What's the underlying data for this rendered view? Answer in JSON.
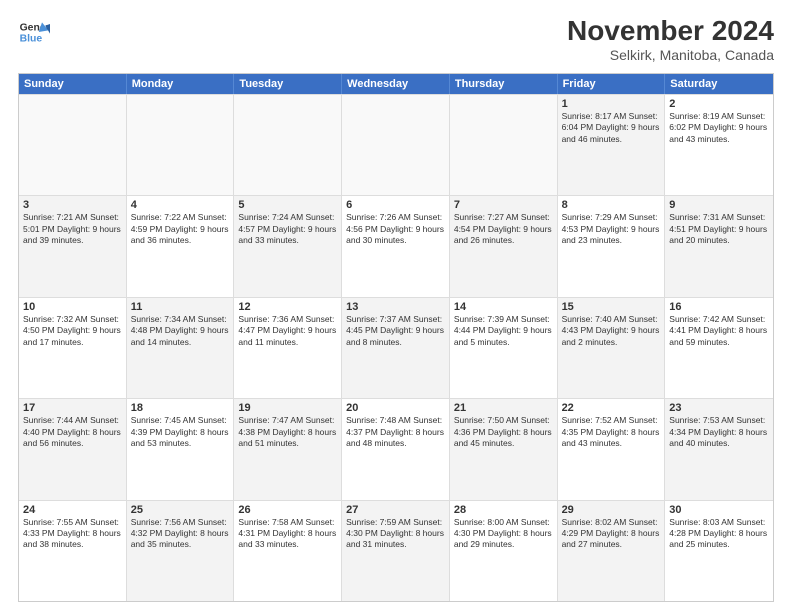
{
  "logo": {
    "line1": "General",
    "line2": "Blue"
  },
  "title": "November 2024",
  "subtitle": "Selkirk, Manitoba, Canada",
  "headers": [
    "Sunday",
    "Monday",
    "Tuesday",
    "Wednesday",
    "Thursday",
    "Friday",
    "Saturday"
  ],
  "rows": [
    [
      {
        "day": "",
        "info": "",
        "empty": true
      },
      {
        "day": "",
        "info": "",
        "empty": true
      },
      {
        "day": "",
        "info": "",
        "empty": true
      },
      {
        "day": "",
        "info": "",
        "empty": true
      },
      {
        "day": "",
        "info": "",
        "empty": true
      },
      {
        "day": "1",
        "info": "Sunrise: 8:17 AM\nSunset: 6:04 PM\nDaylight: 9 hours and 46 minutes.",
        "shaded": true
      },
      {
        "day": "2",
        "info": "Sunrise: 8:19 AM\nSunset: 6:02 PM\nDaylight: 9 hours and 43 minutes."
      }
    ],
    [
      {
        "day": "3",
        "info": "Sunrise: 7:21 AM\nSunset: 5:01 PM\nDaylight: 9 hours and 39 minutes.",
        "shaded": true
      },
      {
        "day": "4",
        "info": "Sunrise: 7:22 AM\nSunset: 4:59 PM\nDaylight: 9 hours and 36 minutes."
      },
      {
        "day": "5",
        "info": "Sunrise: 7:24 AM\nSunset: 4:57 PM\nDaylight: 9 hours and 33 minutes.",
        "shaded": true
      },
      {
        "day": "6",
        "info": "Sunrise: 7:26 AM\nSunset: 4:56 PM\nDaylight: 9 hours and 30 minutes."
      },
      {
        "day": "7",
        "info": "Sunrise: 7:27 AM\nSunset: 4:54 PM\nDaylight: 9 hours and 26 minutes.",
        "shaded": true
      },
      {
        "day": "8",
        "info": "Sunrise: 7:29 AM\nSunset: 4:53 PM\nDaylight: 9 hours and 23 minutes."
      },
      {
        "day": "9",
        "info": "Sunrise: 7:31 AM\nSunset: 4:51 PM\nDaylight: 9 hours and 20 minutes.",
        "shaded": true
      }
    ],
    [
      {
        "day": "10",
        "info": "Sunrise: 7:32 AM\nSunset: 4:50 PM\nDaylight: 9 hours and 17 minutes."
      },
      {
        "day": "11",
        "info": "Sunrise: 7:34 AM\nSunset: 4:48 PM\nDaylight: 9 hours and 14 minutes.",
        "shaded": true
      },
      {
        "day": "12",
        "info": "Sunrise: 7:36 AM\nSunset: 4:47 PM\nDaylight: 9 hours and 11 minutes."
      },
      {
        "day": "13",
        "info": "Sunrise: 7:37 AM\nSunset: 4:45 PM\nDaylight: 9 hours and 8 minutes.",
        "shaded": true
      },
      {
        "day": "14",
        "info": "Sunrise: 7:39 AM\nSunset: 4:44 PM\nDaylight: 9 hours and 5 minutes."
      },
      {
        "day": "15",
        "info": "Sunrise: 7:40 AM\nSunset: 4:43 PM\nDaylight: 9 hours and 2 minutes.",
        "shaded": true
      },
      {
        "day": "16",
        "info": "Sunrise: 7:42 AM\nSunset: 4:41 PM\nDaylight: 8 hours and 59 minutes."
      }
    ],
    [
      {
        "day": "17",
        "info": "Sunrise: 7:44 AM\nSunset: 4:40 PM\nDaylight: 8 hours and 56 minutes.",
        "shaded": true
      },
      {
        "day": "18",
        "info": "Sunrise: 7:45 AM\nSunset: 4:39 PM\nDaylight: 8 hours and 53 minutes."
      },
      {
        "day": "19",
        "info": "Sunrise: 7:47 AM\nSunset: 4:38 PM\nDaylight: 8 hours and 51 minutes.",
        "shaded": true
      },
      {
        "day": "20",
        "info": "Sunrise: 7:48 AM\nSunset: 4:37 PM\nDaylight: 8 hours and 48 minutes."
      },
      {
        "day": "21",
        "info": "Sunrise: 7:50 AM\nSunset: 4:36 PM\nDaylight: 8 hours and 45 minutes.",
        "shaded": true
      },
      {
        "day": "22",
        "info": "Sunrise: 7:52 AM\nSunset: 4:35 PM\nDaylight: 8 hours and 43 minutes."
      },
      {
        "day": "23",
        "info": "Sunrise: 7:53 AM\nSunset: 4:34 PM\nDaylight: 8 hours and 40 minutes.",
        "shaded": true
      }
    ],
    [
      {
        "day": "24",
        "info": "Sunrise: 7:55 AM\nSunset: 4:33 PM\nDaylight: 8 hours and 38 minutes."
      },
      {
        "day": "25",
        "info": "Sunrise: 7:56 AM\nSunset: 4:32 PM\nDaylight: 8 hours and 35 minutes.",
        "shaded": true
      },
      {
        "day": "26",
        "info": "Sunrise: 7:58 AM\nSunset: 4:31 PM\nDaylight: 8 hours and 33 minutes."
      },
      {
        "day": "27",
        "info": "Sunrise: 7:59 AM\nSunset: 4:30 PM\nDaylight: 8 hours and 31 minutes.",
        "shaded": true
      },
      {
        "day": "28",
        "info": "Sunrise: 8:00 AM\nSunset: 4:30 PM\nDaylight: 8 hours and 29 minutes."
      },
      {
        "day": "29",
        "info": "Sunrise: 8:02 AM\nSunset: 4:29 PM\nDaylight: 8 hours and 27 minutes.",
        "shaded": true
      },
      {
        "day": "30",
        "info": "Sunrise: 8:03 AM\nSunset: 4:28 PM\nDaylight: 8 hours and 25 minutes."
      }
    ]
  ]
}
